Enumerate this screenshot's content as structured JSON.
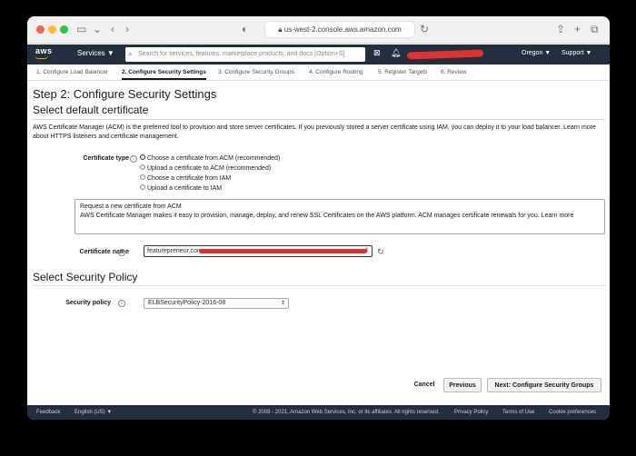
{
  "browser": {
    "url": "us-west-2.console.aws.amazon.com"
  },
  "nav": {
    "logo": "aws",
    "services_label": "Services ▼",
    "search_placeholder": "Search for services, features, marketplace products, and docs [Option+S]",
    "region": "Oregon ▼",
    "support": "Support ▼"
  },
  "steps": [
    "1. Configure Load Balancer",
    "2. Configure Security Settings",
    "3. Configure Security Groups",
    "4. Configure Routing",
    "5. Register Targets",
    "6. Review"
  ],
  "page": {
    "title": "Step 2: Configure Security Settings",
    "section1": "Select default certificate",
    "description": "AWS Certificate Manager (ACM) is the preferred tool to provision and store server certificates. If you previously stored a server certificate using IAM, you can deploy it to your load balancer. Learn more about HTTPS listeners and certificate management.",
    "certificate_type_label": "Certificate type",
    "options": [
      "Choose a certificate from ACM (recommended)",
      "Upload a certificate to ACM (recommended)",
      "Choose a certificate from IAM",
      "Upload a certificate to IAM"
    ],
    "acm_title": "Request a new certificate from ACM",
    "acm_text": "AWS Certificate Manager makes it easy to provision, manage, deploy, and renew SSL Certificates on the AWS platform. ACM manages certificate renewals for you. Learn more",
    "certificate_name_label": "Certificate name",
    "certificate_name_value": "featurepreneur.com",
    "section2": "Select Security Policy",
    "security_policy_label": "Security policy",
    "security_policy_value": "ELBSecurityPolicy-2016-08"
  },
  "buttons": {
    "cancel": "Cancel",
    "previous": "Previous",
    "next": "Next: Configure Security Groups"
  },
  "footer": {
    "feedback": "Feedback",
    "language": "English (US) ▼",
    "copyright": "© 2008 - 2021, Amazon Web Services, Inc. or its affiliates. All rights reserved.",
    "privacy": "Privacy Policy",
    "terms": "Terms of Use",
    "cookies": "Cookie preferences"
  }
}
